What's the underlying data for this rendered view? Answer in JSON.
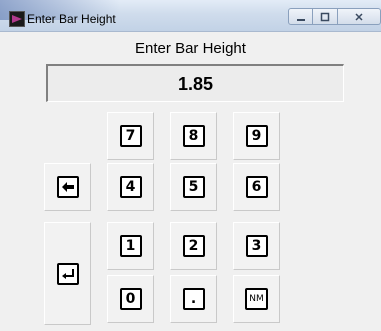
{
  "window": {
    "title": "Enter Bar Height",
    "controls": {
      "minimize": "minimize-icon",
      "maximize": "maximize-icon",
      "close": "close-icon"
    }
  },
  "dialog": {
    "heading": "Enter Bar Height",
    "value": "1.85"
  },
  "keypad": {
    "keys": {
      "seven": "7",
      "eight": "8",
      "nine": "9",
      "four": "4",
      "five": "5",
      "six": "6",
      "one": "1",
      "two": "2",
      "three": "3",
      "zero": "0",
      "point": ".",
      "nm": "NM"
    },
    "backspace_icon": "left-arrow-icon",
    "enter_icon": "enter-return-icon"
  }
}
